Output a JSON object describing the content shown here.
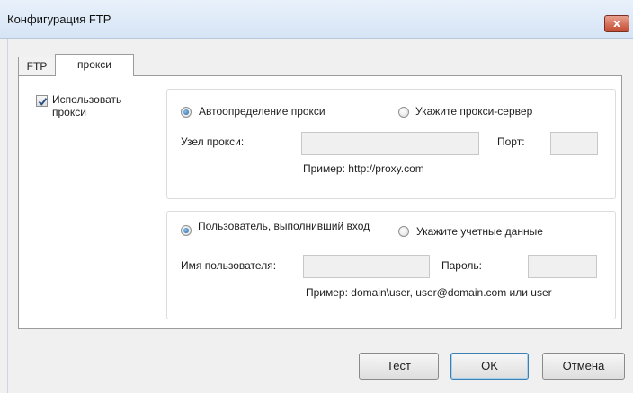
{
  "window": {
    "title": "Конфигурация FTP",
    "close_glyph": "x"
  },
  "tabs": [
    {
      "label": "FTP"
    },
    {
      "label": "прокси"
    }
  ],
  "use_proxy": {
    "label": "Использовать прокси",
    "checked": true
  },
  "proxy_group": {
    "auto_detect_label": "Автоопределение прокси",
    "auto_detect_selected": true,
    "specify_label": "Укажите прокси-сервер",
    "host_label": "Узел прокси:",
    "host_value": "",
    "port_label": "Порт:",
    "port_value": "",
    "example": "Пример: http://proxy.com"
  },
  "credentials_group": {
    "logged_user_label": "Пользователь, выполнивший вход",
    "logged_user_selected": true,
    "specify_label": "Укажите учетные данные",
    "username_label": "Имя пользователя:",
    "username_value": "",
    "password_label": "Пароль:",
    "password_value": "",
    "example": "Пример: domain\\user, user@domain.com или user"
  },
  "buttons": {
    "test": "Тест",
    "ok": "OK",
    "cancel": "Отмена"
  }
}
